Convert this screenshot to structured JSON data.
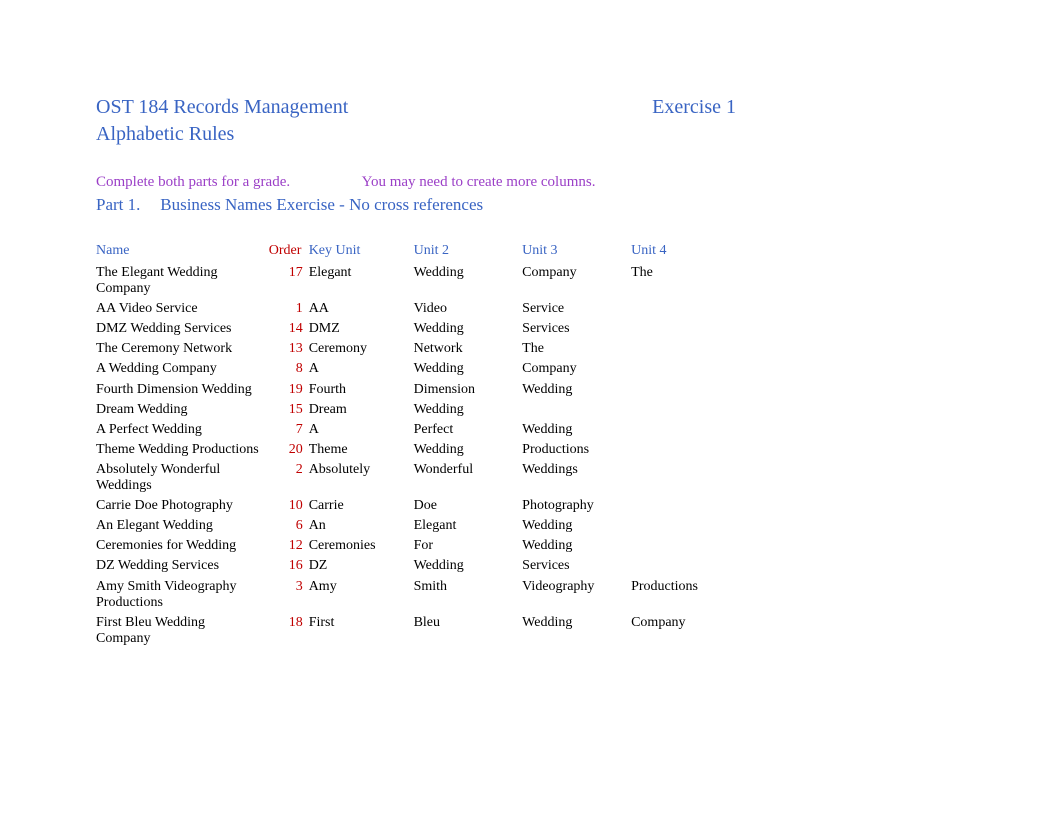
{
  "header": {
    "course": "OST 184 Records Management",
    "exercise": "Exercise 1",
    "subtitle": "Alphabetic Rules"
  },
  "instructions": {
    "left": "Complete both parts for a grade.",
    "right": "You may need to create more columns."
  },
  "part1": {
    "num": "Part 1.",
    "title": "Business Names Exercise - No cross references"
  },
  "table": {
    "headers": {
      "name": "Name",
      "order": "Order",
      "key": "Key Unit",
      "u2": "Unit 2",
      "u3": "Unit 3",
      "u4": "Unit 4"
    },
    "rows": [
      {
        "name": "The Elegant Wedding Company",
        "order": "17",
        "key": "Elegant",
        "u2": "Wedding",
        "u3": "Company",
        "u4": "The"
      },
      {
        "name": "AA Video Service",
        "order": "1",
        "key": "AA",
        "u2": "Video",
        "u3": "Service",
        "u4": ""
      },
      {
        "name": "DMZ Wedding Services",
        "order": "14",
        "key": "DMZ",
        "u2": "Wedding",
        "u3": "Services",
        "u4": ""
      },
      {
        "name": "The Ceremony Network",
        "order": "13",
        "key": "Ceremony",
        "u2": "Network",
        "u3": "The",
        "u4": ""
      },
      {
        "name": "A Wedding Company",
        "order": "8",
        "key": "A",
        "u2": "Wedding",
        "u3": "Company",
        "u4": ""
      },
      {
        "name": "Fourth Dimension Wedding",
        "order": "19",
        "key": "Fourth",
        "u2": "Dimension",
        "u3": "Wedding",
        "u4": ""
      },
      {
        "name": "Dream Wedding",
        "order": "15",
        "key": "Dream",
        "u2": "Wedding",
        "u3": "",
        "u4": ""
      },
      {
        "name": "A Perfect Wedding",
        "order": "7",
        "key": "A",
        "u2": "Perfect",
        "u3": "Wedding",
        "u4": ""
      },
      {
        "name": "Theme Wedding Productions",
        "order": "20",
        "key": "Theme",
        "u2": "Wedding",
        "u3": "Productions",
        "u4": ""
      },
      {
        "name": "Absolutely Wonderful Weddings",
        "order": "2",
        "key": "Absolutely",
        "u2": "Wonderful",
        "u3": "Weddings",
        "u4": ""
      },
      {
        "name": "Carrie Doe Photography",
        "order": "10",
        "key": "Carrie",
        "u2": "Doe",
        "u3": "Photography",
        "u4": ""
      },
      {
        "name": "An Elegant Wedding",
        "order": "6",
        "key": "An",
        "u2": "Elegant",
        "u3": "Wedding",
        "u4": ""
      },
      {
        "name": "Ceremonies for Wedding",
        "order": "12",
        "key": "Ceremonies",
        "u2": "For",
        "u3": "Wedding",
        "u4": ""
      },
      {
        "name": "DZ Wedding Services",
        "order": "16",
        "key": "DZ",
        "u2": "Wedding",
        "u3": "Services",
        "u4": ""
      },
      {
        "name": "Amy Smith Videography Productions",
        "order": "3",
        "key": "Amy",
        "u2": "Smith",
        "u3": "Videography",
        "u4": "Productions"
      },
      {
        "name": "First Bleu Wedding Company",
        "order": "18",
        "key": "First",
        "u2": "Bleu",
        "u3": "Wedding",
        "u4": "Company"
      }
    ]
  }
}
